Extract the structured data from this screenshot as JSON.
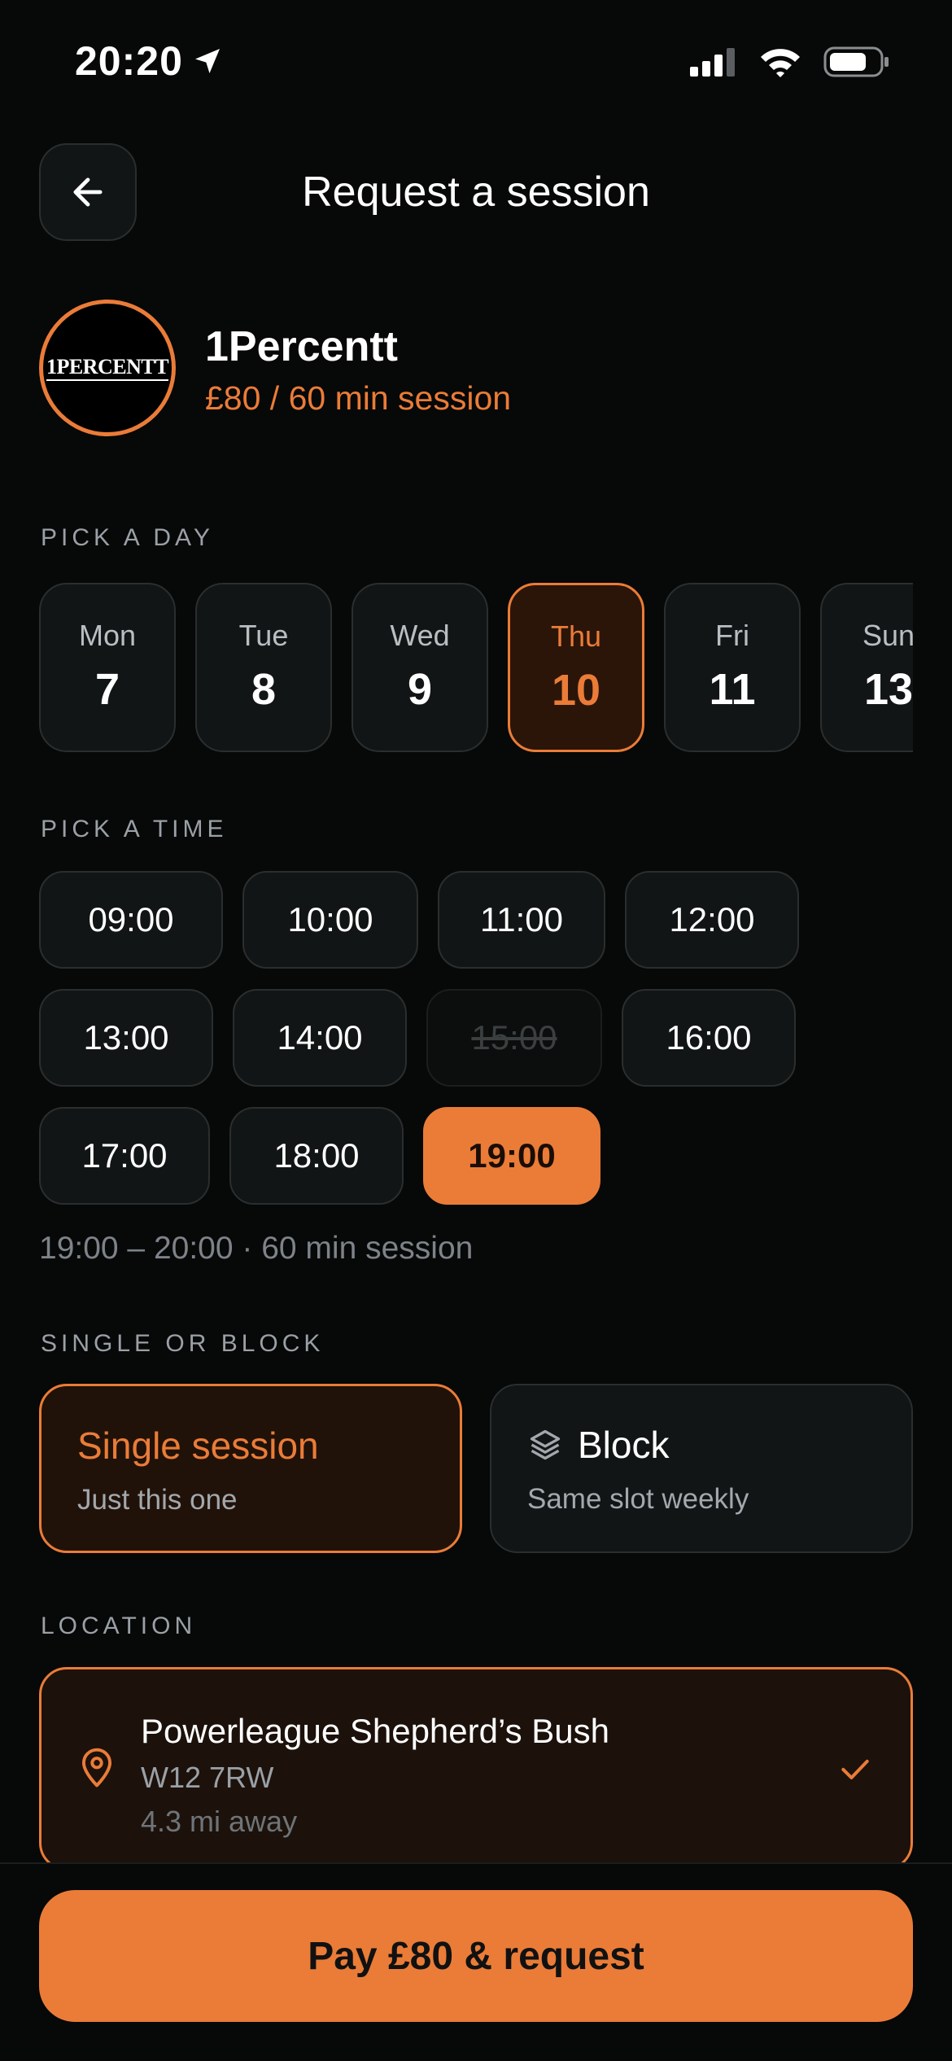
{
  "status_bar": {
    "time": "20:20"
  },
  "header": {
    "title": "Request a session"
  },
  "coach": {
    "name": "1Percentt",
    "logo_text": "1PERCENTT",
    "price": "£80 / 60 min session"
  },
  "days_section": {
    "label": "PICK A DAY",
    "days": [
      {
        "name": "Mon",
        "num": "7"
      },
      {
        "name": "Tue",
        "num": "8"
      },
      {
        "name": "Wed",
        "num": "9"
      },
      {
        "name": "Thu",
        "num": "10"
      },
      {
        "name": "Fri",
        "num": "11"
      },
      {
        "name": "Sun",
        "num": "13"
      }
    ],
    "selected": "Thu"
  },
  "times_section": {
    "label": "PICK A TIME",
    "times": [
      "09:00",
      "10:00",
      "11:00",
      "12:00",
      "13:00",
      "14:00",
      "15:00",
      "16:00",
      "17:00",
      "18:00",
      "19:00"
    ],
    "unavailable": "15:00",
    "selected": "19:00",
    "summary": "19:00 – 20:00 · 60 min session"
  },
  "type_section": {
    "label": "SINGLE OR BLOCK",
    "single": {
      "title": "Single session",
      "subtitle": "Just this one"
    },
    "block": {
      "title": "Block",
      "subtitle": "Same slot weekly"
    },
    "selected": "single"
  },
  "location_section": {
    "label": "LOCATION",
    "name": "Powerleague Shepherd’s Bush",
    "postcode": "W12 7RW",
    "distance": "4.3 mi away"
  },
  "footer": {
    "pay_label": "Pay £80 & request"
  },
  "colors": {
    "accent": "#ea7c38",
    "background": "#070808",
    "card": "#121515"
  }
}
